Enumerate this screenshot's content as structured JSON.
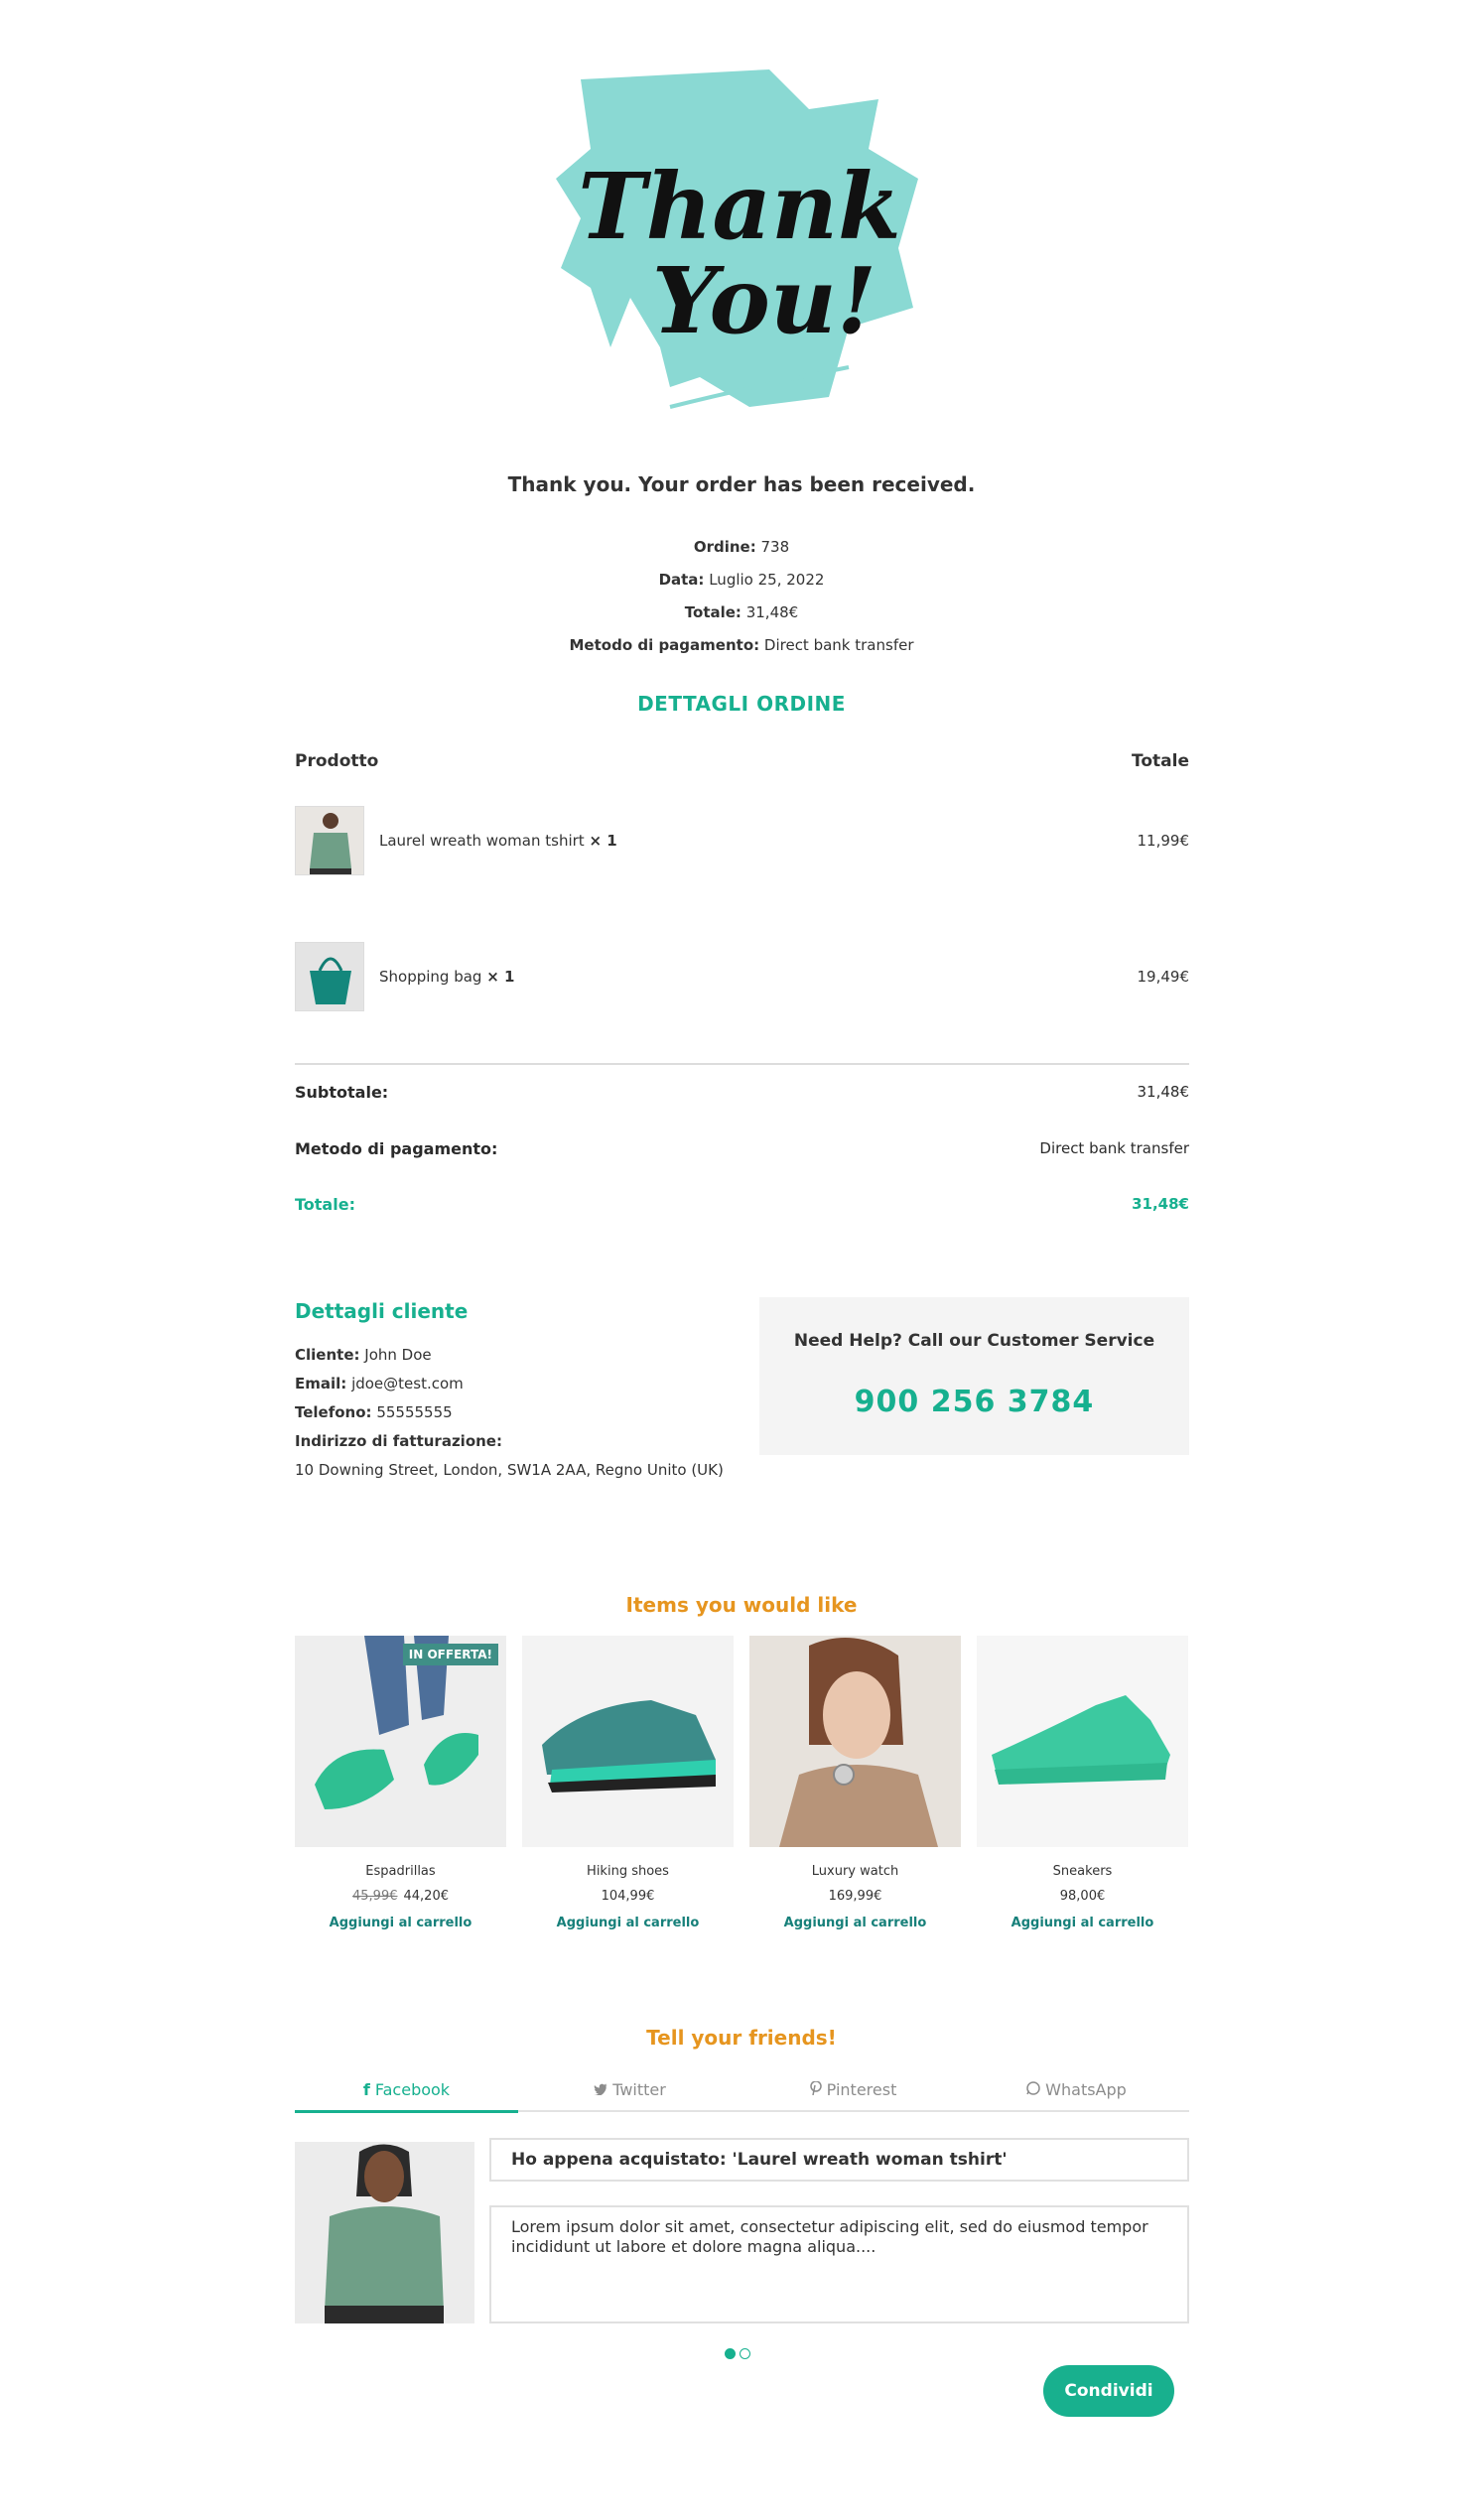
{
  "logo": {
    "line1": "Thank",
    "line2": "You!"
  },
  "confirmation": {
    "message": "Thank you. Your order has been received."
  },
  "order": {
    "number_label": "Ordine:",
    "number": "738",
    "date_label": "Data:",
    "date": "Luglio 25, 2022",
    "total_label": "Totale:",
    "total": "31,48€",
    "payment_label": "Metodo di pagamento:",
    "payment": "Direct bank transfer"
  },
  "details": {
    "title": "DETTAGLI ORDINE",
    "col_product": "Prodotto",
    "col_total": "Totale",
    "items": [
      {
        "name": "Laurel wreath woman tshirt",
        "qty": "× 1",
        "price": "11,99€"
      },
      {
        "name": "Shopping bag",
        "qty": "× 1",
        "price": "19,49€"
      }
    ],
    "subtotal_label": "Subtotale:",
    "subtotal": "31,48€",
    "payment_label": "Metodo di pagamento:",
    "payment": "Direct bank transfer",
    "total_label": "Totale:",
    "total": "31,48€"
  },
  "customer": {
    "title": "Dettagli cliente",
    "name_label": "Cliente:",
    "name": "John Doe",
    "email_label": "Email:",
    "email": "jdoe@test.com",
    "phone_label": "Telefono:",
    "phone": "55555555",
    "billing_label": "Indirizzo di fatturazione:",
    "address": "10 Downing Street, London, SW1A 2AA, Regno Unito (UK)"
  },
  "help": {
    "title": "Need Help? Call our Customer Service",
    "phone": "900 256 3784"
  },
  "recommended": {
    "title": "Items you would like",
    "badge": "IN OFFERTA!",
    "cart_label": "Aggiungi al carrello",
    "products": [
      {
        "name": "Espadrillas",
        "old_price": "45,99€",
        "price": "44,20€"
      },
      {
        "name": "Hiking shoes",
        "price": "104,99€"
      },
      {
        "name": "Luxury watch",
        "price": "169,99€"
      },
      {
        "name": "Sneakers",
        "price": "98,00€"
      }
    ]
  },
  "share": {
    "title": "Tell your friends!",
    "tabs": [
      {
        "label": "Facebook",
        "icon": "facebook-icon",
        "glyph": "f"
      },
      {
        "label": "Twitter",
        "icon": "twitter-icon",
        "glyph": "🐦"
      },
      {
        "label": "Pinterest",
        "icon": "pinterest-icon",
        "glyph": "℗"
      },
      {
        "label": "WhatsApp",
        "icon": "whatsapp-icon",
        "glyph": "◌"
      }
    ],
    "post_title": "Ho appena acquistato: 'Laurel wreath woman tshirt'",
    "post_message": "Lorem ipsum dolor sit amet, consectetur adipiscing elit, sed do eiusmod tempor incididunt ut labore et dolore magna aliqua....",
    "button": "Condividi"
  },
  "colors": {
    "accent": "#17b08f",
    "orange": "#e6951f",
    "logo_brush": "#8ad9d3"
  }
}
